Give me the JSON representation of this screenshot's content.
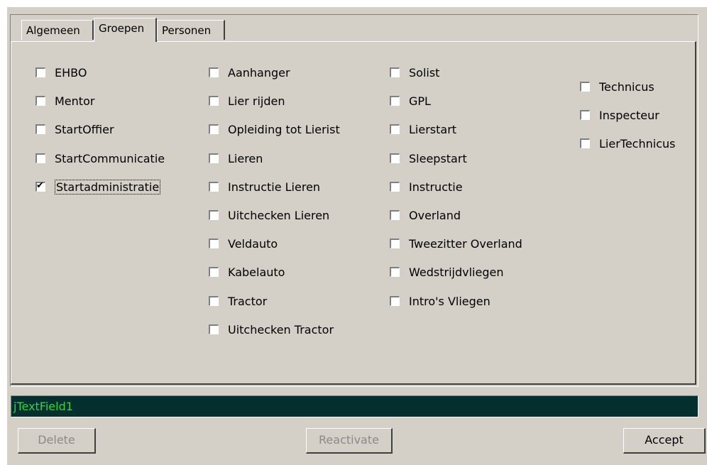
{
  "tabs": [
    {
      "label": "Algemeen",
      "active": false
    },
    {
      "label": "Groepen",
      "active": true
    },
    {
      "label": "Personen",
      "active": false
    }
  ],
  "columns": [
    [
      {
        "label": "EHBO",
        "checked": false
      },
      {
        "label": "Mentor",
        "checked": false
      },
      {
        "label": "StartOffier",
        "checked": false
      },
      {
        "label": "StartCommunicatie",
        "checked": false
      },
      {
        "label": "Startadministratie",
        "checked": true,
        "focused": true
      }
    ],
    [
      {
        "label": "Aanhanger",
        "checked": false
      },
      {
        "label": "Lier rijden",
        "checked": false
      },
      {
        "label": "Opleiding tot Lierist",
        "checked": false
      },
      {
        "label": "Lieren",
        "checked": false
      },
      {
        "label": "Instructie Lieren",
        "checked": false
      },
      {
        "label": "Uitchecken Lieren",
        "checked": false
      },
      {
        "label": "Veldauto",
        "checked": false
      },
      {
        "label": "Kabelauto",
        "checked": false
      },
      {
        "label": "Tractor",
        "checked": false
      },
      {
        "label": "Uitchecken Tractor",
        "checked": false
      }
    ],
    [
      {
        "label": "Solist",
        "checked": false
      },
      {
        "label": "GPL",
        "checked": false
      },
      {
        "label": "Lierstart",
        "checked": false
      },
      {
        "label": "Sleepstart",
        "checked": false
      },
      {
        "label": "Instructie",
        "checked": false
      },
      {
        "label": "Overland",
        "checked": false
      },
      {
        "label": "Tweezitter Overland",
        "checked": false
      },
      {
        "label": "Wedstrijdvliegen",
        "checked": false
      },
      {
        "label": "Intro's Vliegen",
        "checked": false
      }
    ],
    [
      {
        "label": "Technicus",
        "checked": false
      },
      {
        "label": "Inspecteur",
        "checked": false
      },
      {
        "label": "LierTechnicus",
        "checked": false
      }
    ]
  ],
  "textfield": {
    "value": "jTextField1"
  },
  "buttons": {
    "delete": "Delete",
    "reactivate": "Reactivate",
    "accept": "Accept"
  },
  "colors": {
    "window_bg": "#d4d0c8",
    "textfield_bg": "#03302e",
    "textfield_text": "#36d33c"
  }
}
